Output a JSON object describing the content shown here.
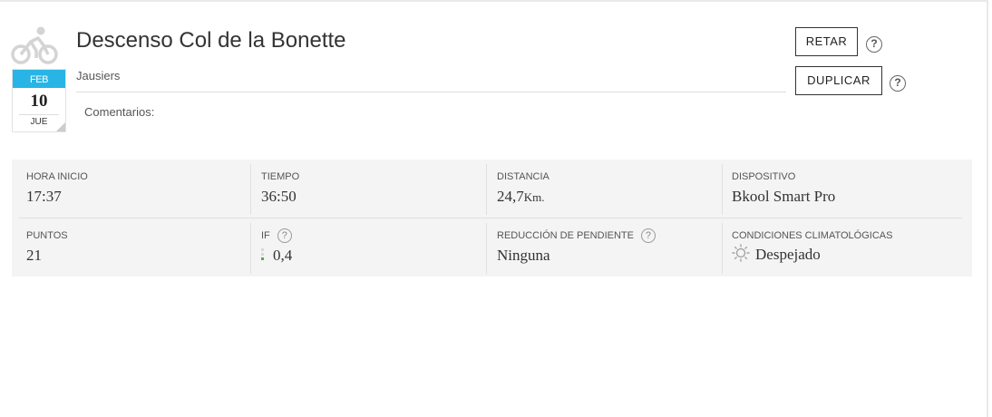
{
  "activity": {
    "title": "Descenso Col de la Bonette",
    "location": "Jausiers",
    "comments_label": "Comentarios:",
    "icon": "bike-icon"
  },
  "calendar": {
    "month": "FEB",
    "day": "10",
    "weekday": "JUE"
  },
  "actions": {
    "retar_label": "RETAR",
    "duplicar_label": "DUPLICAR",
    "help_glyph": "?"
  },
  "stats": {
    "start_time": {
      "label": "HORA INICIO",
      "value": "17:37"
    },
    "time": {
      "label": "TIEMPO",
      "value": "36:50"
    },
    "distance": {
      "label": "DISTANCIA",
      "value": "24,7",
      "unit": "Km."
    },
    "device": {
      "label": "DISPOSITIVO",
      "value": "Bkool Smart Pro"
    },
    "points": {
      "label": "PUNTOS",
      "value": "21"
    },
    "if": {
      "label": "IF",
      "value": "0,4",
      "level_fraction": 0.3,
      "level_color": "#4caf50"
    },
    "slope_reduction": {
      "label": "REDUCCIÓN DE PENDIENTE",
      "value": "Ninguna"
    },
    "weather": {
      "label": "CONDICIONES CLIMATOLÓGICAS",
      "value": "Despejado",
      "icon": "sun-icon"
    }
  },
  "colors": {
    "calendar_accent": "#28b5e6",
    "panel_bg": "#f4f4f4"
  }
}
